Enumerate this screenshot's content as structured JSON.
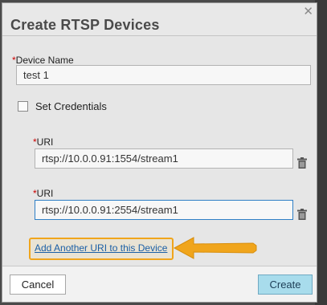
{
  "dialog": {
    "title": "Create RTSP Devices",
    "close_icon": "close-icon"
  },
  "form": {
    "device_name": {
      "required_mark": "*",
      "label": "Device Name",
      "value": "test 1"
    },
    "set_credentials": {
      "label": "Set Credentials",
      "checked": false
    },
    "uris": [
      {
        "required_mark": "*",
        "label": "URI",
        "value": "rtsp://10.0.0.91:1554/stream1",
        "delete_icon": "trash-icon"
      },
      {
        "required_mark": "*",
        "label": "URI",
        "value": "rtsp://10.0.0.91:2554/stream1",
        "delete_icon": "trash-icon"
      }
    ],
    "add_uri_link": "Add Another URI to this Device"
  },
  "footer": {
    "cancel_label": "Cancel",
    "create_label": "Create"
  },
  "colors": {
    "highlight": "#f0a51c",
    "link": "#1b5fa6",
    "primary_button": "#a8dcec",
    "required": "#cc0000"
  }
}
